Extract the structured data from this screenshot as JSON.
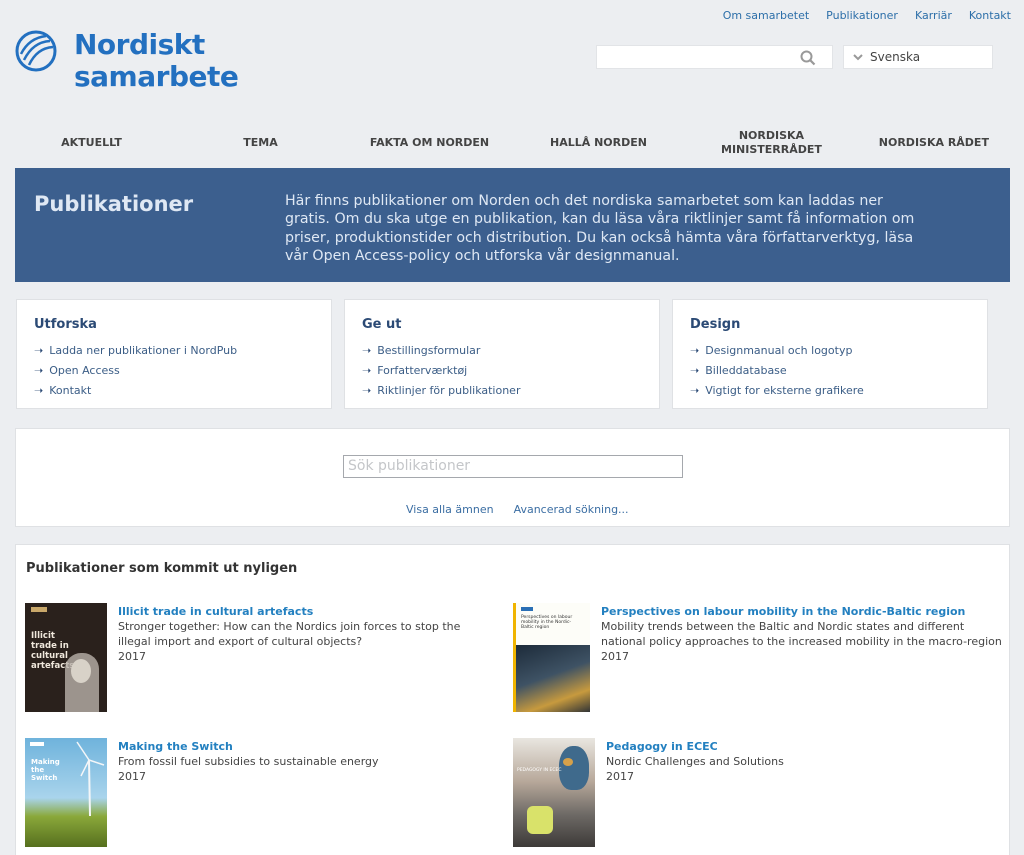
{
  "toplinks": [
    "Om samarbetet",
    "Publikationer",
    "Karriär",
    "Kontakt"
  ],
  "logo": {
    "line1": "Nordiskt",
    "line2": "samarbete"
  },
  "search": {
    "placeholder": ""
  },
  "language": {
    "selected": "Svenska"
  },
  "nav": [
    "AKTUELLT",
    "TEMA",
    "FAKTA OM NORDEN",
    "HALLÅ NORDEN",
    "NORDISKA MINISTERRÅDET",
    "NORDISKA RÅDET"
  ],
  "hero": {
    "title": "Publikationer",
    "text": "Här finns publikationer om Norden och det nordiska samarbetet som kan laddas ner gratis. Om du ska utge en publikation, kan du läsa våra riktlinjer samt få information om priser, produktionstider och distribution. Du kan också hämta våra författarverktyg, läsa vår Open Access-policy och utforska vår designmanual."
  },
  "cards": [
    {
      "title": "Utforska",
      "links": [
        "Ladda ner publikationer i NordPub",
        "Open Access",
        "Kontakt"
      ]
    },
    {
      "title": "Ge ut",
      "links": [
        "Bestillingsformular",
        "Forfatterværktøj",
        "Riktlinjer för publikationer"
      ]
    },
    {
      "title": "Design",
      "links": [
        "Designmanual och logotyp",
        "Billeddatabase",
        "Vigtigt for eksterne grafikere"
      ]
    }
  ],
  "pubsearch": {
    "placeholder": "Sök publikationer",
    "link_all": "Visa alla ämnen",
    "link_adv": "Avancerad sökning..."
  },
  "recent": {
    "heading": "Publikationer som kommit ut nyligen",
    "items": [
      {
        "title": "Illicit trade in cultural artefacts",
        "desc": "Stronger together: How can the Nordics join forces to stop the illegal import and export of cultural objects?",
        "year": "2017",
        "cover_text": "Illicit trade in cultural artefacts"
      },
      {
        "title": "Perspectives on labour mobility in the Nordic-Baltic region",
        "desc": "Mobility trends between the Baltic and Nordic states and different national policy approaches to the increased mobility in the macro-region",
        "year": "2017",
        "cover_text": "Perspectives on labour mobility in the Nordic-Baltic region"
      },
      {
        "title": "Making the Switch",
        "desc": "From fossil fuel subsidies to sustainable energy",
        "year": "2017",
        "cover_text": "Making the Switch"
      },
      {
        "title": "Pedagogy in ECEC",
        "desc": "Nordic Challenges and Solutions",
        "year": "2017",
        "cover_text": "PEDAGOGY IN ECEC"
      }
    ]
  },
  "colors": {
    "brand": "#2370c0",
    "hero_bg": "#3c5f8e",
    "link": "#2380c0",
    "page_bg": "#eceef1"
  }
}
